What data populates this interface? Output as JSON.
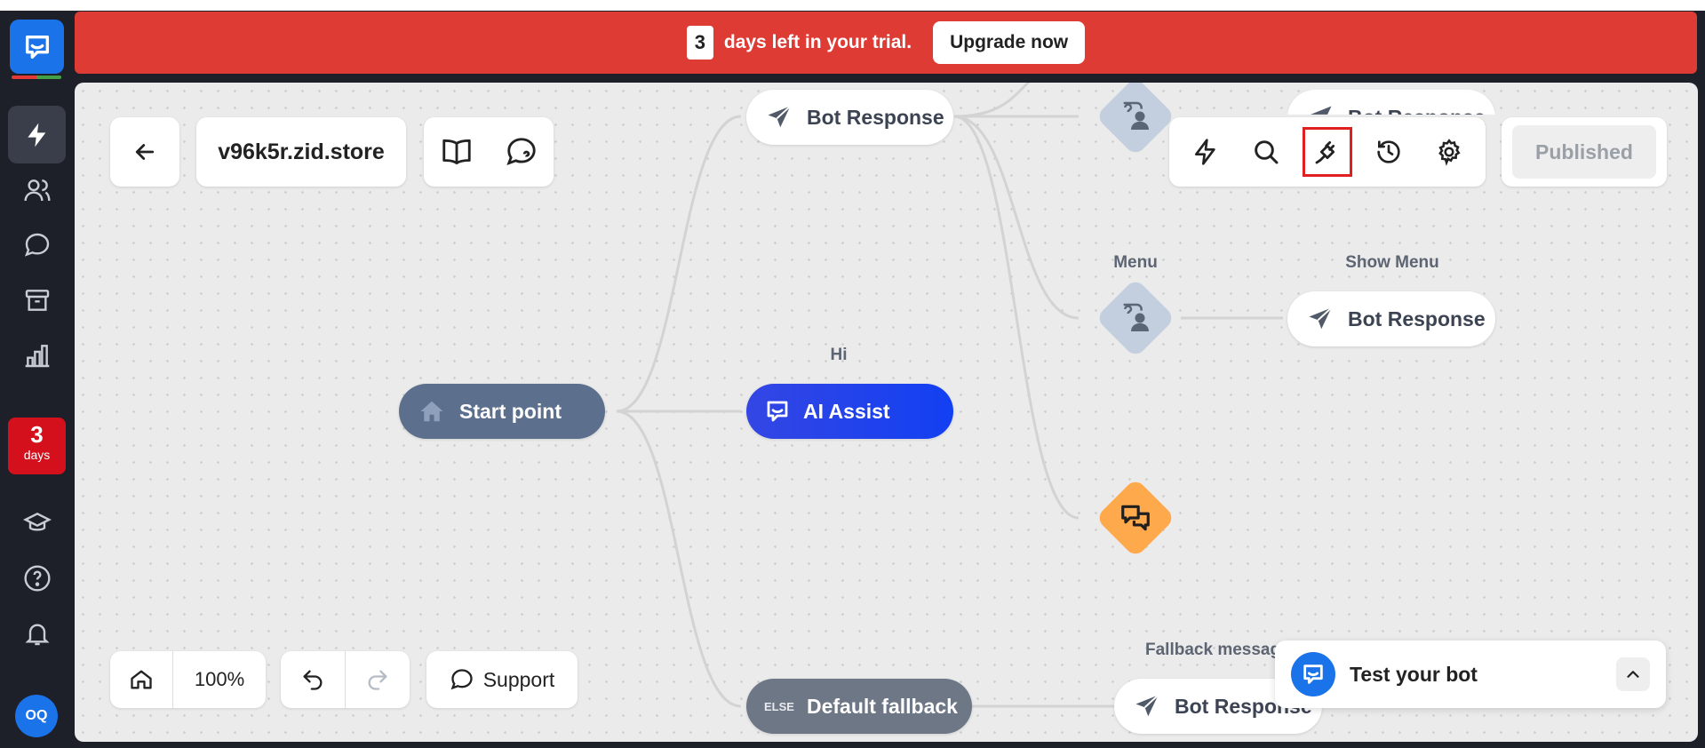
{
  "banner": {
    "days_count": "3",
    "message": "days left in your trial.",
    "upgrade_label": "Upgrade now",
    "color": "#de3b35"
  },
  "rail": {
    "days_badge_number": "3",
    "days_badge_label": "days",
    "avatar_initials": "OQ",
    "items": [
      "automation-icon",
      "contacts-icon",
      "chat-icon",
      "archive-icon",
      "reports-icon",
      "academy-icon",
      "help-icon",
      "notifications-icon"
    ]
  },
  "header": {
    "bot_name": "v96k5r.zid.store"
  },
  "toolbar": {
    "items": [
      "lightning-icon",
      "search-icon",
      "integrations-plug-icon",
      "history-icon",
      "settings-icon"
    ],
    "published_label": "Published"
  },
  "flow": {
    "start_label": "Start point",
    "ai_assist_title": "Hi",
    "ai_assist_label": "AI Assist",
    "top_bot_response": "Bot Response",
    "menu_title": "Menu",
    "show_menu_title": "Show Menu",
    "show_menu_response": "Bot Response",
    "partial_top_response": "Bot Response",
    "fallback_label": "Default fallback",
    "fallback_tag": "ELSE",
    "fallback_message_title": "Fallback message",
    "fallback_bot_response": "Bot Response"
  },
  "bottom_controls": {
    "zoom_level": "100%",
    "support_label": "Support"
  },
  "test_panel": {
    "label": "Test your bot"
  },
  "colors": {
    "accent": "#1a73e8",
    "start_node": "#5c6f8d",
    "ai_node": "#1f4bf0",
    "fallback_node": "#6e7786",
    "orange_diamond": "#ffa94d",
    "blue_gray_diamond": "#c3cfdf"
  }
}
